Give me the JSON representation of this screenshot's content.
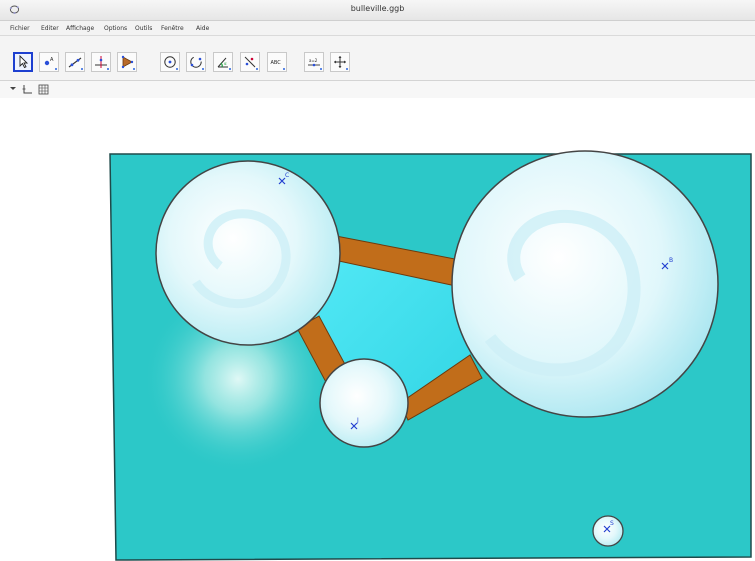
{
  "window": {
    "title": "bulleville.ggb",
    "icon": "geogebra-logo-icon"
  },
  "menu": [
    {
      "label": "Fichier"
    },
    {
      "label": "Editer"
    },
    {
      "label": "Affichage"
    },
    {
      "label": "Options"
    },
    {
      "label": "Outils"
    },
    {
      "label": "Fenêtre"
    },
    {
      "label": "Aide"
    }
  ],
  "toolbar": {
    "tools": [
      {
        "icon": "move-arrow-icon",
        "selected": true
      },
      {
        "icon": "point-icon",
        "selected": false
      },
      {
        "icon": "line-icon",
        "selected": false
      },
      {
        "icon": "perpendicular-line-icon",
        "selected": false
      },
      {
        "icon": "polygon-icon",
        "selected": false
      },
      {
        "icon": "circle-center-icon",
        "selected": false
      },
      {
        "icon": "circle-arc-icon",
        "selected": false
      },
      {
        "icon": "angle-icon",
        "selected": false
      },
      {
        "icon": "reflect-icon",
        "selected": false
      },
      {
        "icon": "text-icon",
        "label": "ABC",
        "selected": false
      },
      {
        "icon": "slider-icon",
        "label": "a=2",
        "selected": false
      },
      {
        "icon": "move-view-icon",
        "selected": false
      }
    ]
  },
  "stylebar": {
    "items": [
      {
        "icon": "dropdown-triangle-icon"
      },
      {
        "icon": "axes-icon"
      },
      {
        "icon": "grid-icon"
      }
    ]
  },
  "graphics": {
    "background_color": "#2cc8c8",
    "bubble_color": "#dff7fb",
    "bridge_color": "#c16d1a",
    "points": [
      {
        "label": "C"
      },
      {
        "label": "B"
      },
      {
        "label": "J"
      },
      {
        "label": "S"
      }
    ]
  }
}
